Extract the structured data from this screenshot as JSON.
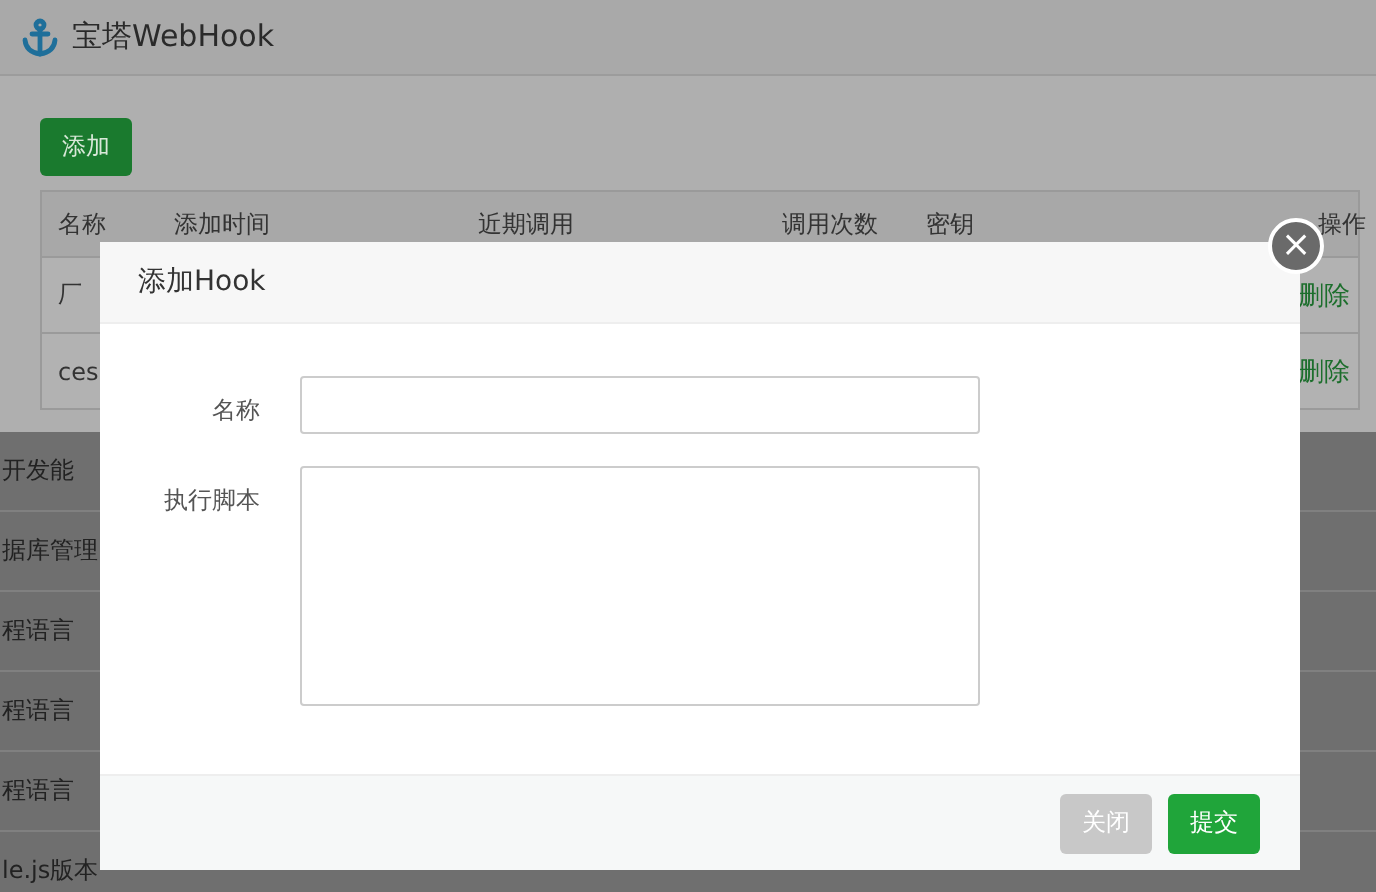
{
  "window": {
    "title": "宝塔WebHook"
  },
  "add_button": "添加",
  "table": {
    "columns": [
      "名称",
      "添加时间",
      "近期调用",
      "调用次数",
      "密钥",
      "操作"
    ],
    "rows": [
      {
        "name": "厂",
        "action": "删除"
      },
      {
        "name": "ces",
        "action": "删除"
      }
    ]
  },
  "background_list": [
    "开发能",
    "据库管理",
    "程语言",
    "程语言",
    "程语言",
    "le.js版本"
  ],
  "dialog": {
    "title": "添加Hook",
    "close": "×",
    "fields": [
      {
        "label": "名称",
        "kind": "input"
      },
      {
        "label": "执行脚本",
        "kind": "textarea"
      }
    ],
    "buttons": [
      {
        "label": "关闭",
        "kind": "secondary"
      },
      {
        "label": "提交",
        "kind": "primary"
      }
    ]
  }
}
